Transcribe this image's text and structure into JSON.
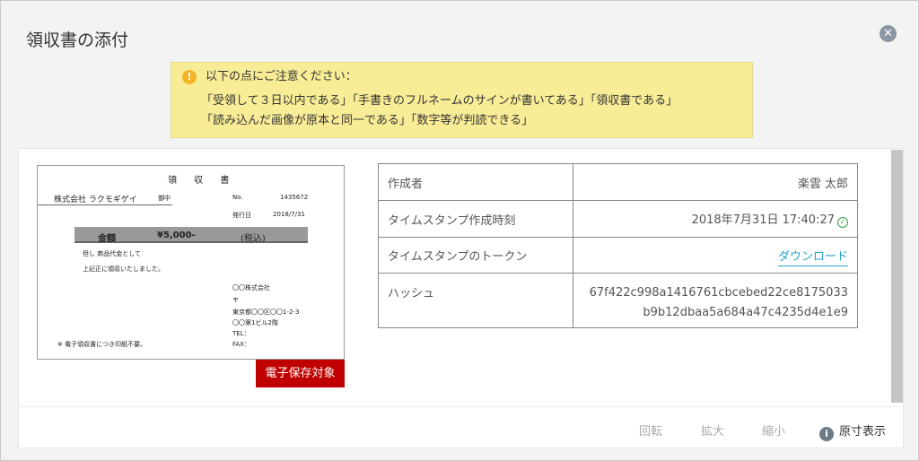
{
  "dialog": {
    "title": "領収書の添付",
    "close_icon": "close-icon"
  },
  "notice": {
    "icon": "warning-icon",
    "heading": "以下の点にご注意ください：",
    "line1": "「受領して３日以内である」「手書きのフルネームのサインが書いてある」「領収書である」",
    "line2": "「読み込んだ画像が原本と同一である」「数字等が判読できる」"
  },
  "receipt": {
    "title": "領 収 書",
    "company": "株式会社 ラクモギゲイ",
    "onchu": "御中",
    "no_label": "No.",
    "no_value": "1435672",
    "date_label": "発行日",
    "date_value": "2018/7/31",
    "amount_label": "金額",
    "amount_value": "¥5,000-",
    "tax_note": "(税込)",
    "tadashi": "但し 商品代金として",
    "received": "上記正に領収いたしました。",
    "issuer_corp": "〇〇株式会社",
    "postal": "〒",
    "address1": "東京都〇〇区〇〇1-2-3",
    "address2": "〇〇第1ビル2階",
    "tel": "TEL：",
    "fax": "FAX：",
    "note": "※ 電子領収書につき印紙不要。"
  },
  "stamp_badge": "電子保存対象",
  "info": {
    "rows": [
      {
        "key": "作成者",
        "value": "楽雲 太郎"
      },
      {
        "key": "タイムスタンプ作成時刻",
        "value": "2018年7月31日 17:40:27"
      },
      {
        "key": "タイムスタンプのトークン",
        "value": "ダウンロード"
      },
      {
        "key": "ハッシュ",
        "value_line1": "67f422c998a1416761cbcebed22ce8175033",
        "value_line2": "b9b12dbaa5a684a47c4235d4e1e9"
      }
    ],
    "verified_icon": "check-circle-icon"
  },
  "toolbar": {
    "rotate": "回転",
    "zoom_in": "拡大",
    "zoom_out": "縮小",
    "actual_size": "原寸表示",
    "actual_size_icon": "info-icon"
  },
  "colors": {
    "notice_bg": "#f8ed96",
    "badge_red": "#c00000",
    "link_blue": "#2aa3c9",
    "verified_green": "#2ea043"
  }
}
